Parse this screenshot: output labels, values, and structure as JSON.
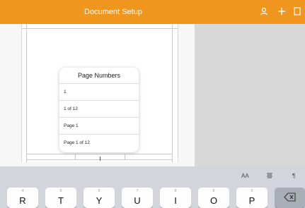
{
  "titlebar": {
    "title": "Document Setup",
    "color": "#f0961f"
  },
  "popover": {
    "title": "Page Numbers",
    "options": [
      "1",
      "1 of 12",
      "Page 1",
      "Page 1 of 12"
    ]
  },
  "toolbar": {
    "font_size_label": "AA",
    "align_icon": "align-icon",
    "paragraph_label": "¶"
  },
  "keyboard": {
    "keys": [
      {
        "num": "4",
        "letter": "R"
      },
      {
        "num": "5",
        "letter": "T"
      },
      {
        "num": "6",
        "letter": "Y"
      },
      {
        "num": "7",
        "letter": "U"
      },
      {
        "num": "8",
        "letter": "I"
      },
      {
        "num": "9",
        "letter": "O"
      },
      {
        "num": "0",
        "letter": "P"
      }
    ],
    "delete_icon": "delete-icon"
  }
}
